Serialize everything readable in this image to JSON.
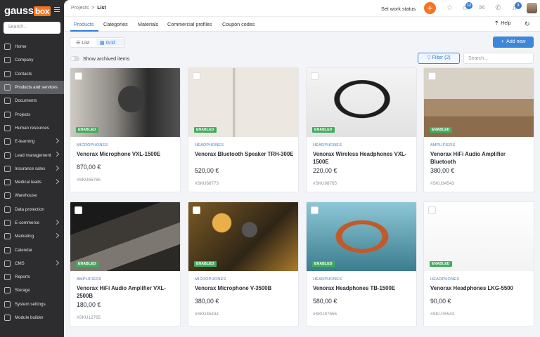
{
  "app": {
    "logo_text": "gauss",
    "logo_box": "box",
    "search_placeholder": "Search...",
    "brand_color": "#f37421",
    "accent_color": "#3d87d9"
  },
  "sidebar": {
    "items": [
      {
        "label": "Home",
        "icon": "home-icon",
        "chevron": false
      },
      {
        "label": "Company",
        "icon": "company-icon",
        "chevron": false
      },
      {
        "label": "Contacts",
        "icon": "contacts-icon",
        "chevron": false
      },
      {
        "label": "Products and services",
        "icon": "box-icon",
        "chevron": false,
        "active": true
      },
      {
        "label": "Documents",
        "icon": "document-icon",
        "chevron": false
      },
      {
        "label": "Projects",
        "icon": "folder-icon",
        "chevron": false
      },
      {
        "label": "Human resources",
        "icon": "people-icon",
        "chevron": false
      },
      {
        "label": "E-learning",
        "icon": "graduation-icon",
        "chevron": true
      },
      {
        "label": "Lead management",
        "icon": "funnel-icon",
        "chevron": true
      },
      {
        "label": "Insurance sales",
        "icon": "umbrella-icon",
        "chevron": true
      },
      {
        "label": "Medical leads",
        "icon": "medical-icon",
        "chevron": true
      },
      {
        "label": "Warehouse",
        "icon": "warehouse-icon",
        "chevron": false
      },
      {
        "label": "Data protection",
        "icon": "shield-icon",
        "chevron": false
      },
      {
        "label": "E-commerce",
        "icon": "cart-icon",
        "chevron": true
      },
      {
        "label": "Marketing",
        "icon": "megaphone-icon",
        "chevron": true
      },
      {
        "label": "Calendar",
        "icon": "calendar-icon",
        "chevron": false
      },
      {
        "label": "CMS",
        "icon": "cms-icon",
        "chevron": true
      },
      {
        "label": "Reports",
        "icon": "chart-icon",
        "chevron": false
      },
      {
        "label": "Storage",
        "icon": "storage-icon",
        "chevron": false
      },
      {
        "label": "System settings",
        "icon": "gear-icon",
        "chevron": false
      },
      {
        "label": "Module builder",
        "icon": "module-icon",
        "chevron": false
      }
    ]
  },
  "topbar": {
    "breadcrumb_parent": "Projects",
    "breadcrumb_sep": ">",
    "breadcrumb_current": "List",
    "work_status": "Set work status",
    "chat_badge": "12",
    "notif_badge": "3"
  },
  "tabs": {
    "items": [
      "Products",
      "Categories",
      "Materials",
      "Commercial profiles",
      "Coupon codes"
    ],
    "help": "Help"
  },
  "toolbar": {
    "list_label": "List",
    "grid_label": "Grid",
    "add_label": "Add new",
    "archived_label": "Show archived items",
    "filter_label": "Filter (2)",
    "search_placeholder": "Search..."
  },
  "products": [
    {
      "status": "ENABLED",
      "category": "MICROPHONES",
      "name": "Venorax Microphone VXL-1500E",
      "price": "870,00 €",
      "sku": "#SKU65765"
    },
    {
      "status": "ENABLED",
      "category": "HEADPHONES",
      "name": "Venorax Bluetooth Speaker TRH-300E",
      "price": "520,00 €",
      "sku": "#SKU68773"
    },
    {
      "status": "ENABLED",
      "category": "HEADPHONES",
      "name": "Venorax Wireless Headphones VXL-1500E",
      "price": "220,00 €",
      "sku": "#SKU98765"
    },
    {
      "status": "ENABLED",
      "category": "AMPLIFIERS",
      "name": "Venorax HiFi Audio Amplifier Bluetooth",
      "price": "380,00 €",
      "sku": "#SKU34543"
    },
    {
      "status": "ENABLED",
      "category": "AMPLIFIERS",
      "name": "Venorax HiFi Audio Amplifier VXL-2500B",
      "price": "180,00 €",
      "sku": "#SKU12765"
    },
    {
      "status": "ENABLED",
      "category": "MICROPHONES",
      "name": "Venorax Microphone V-3500B",
      "price": "380,00 €",
      "sku": "#SKU45434"
    },
    {
      "status": "ENABLED",
      "category": "HEADPHONES",
      "name": "Venorax Headphones TB-1500E",
      "price": "580,00 €",
      "sku": "#SKU87656"
    },
    {
      "status": "ENABLED",
      "category": "HEADPHONES",
      "name": "Venorax Headphones LKG-5500",
      "price": "90,00 €",
      "sku": "#SKU76543"
    }
  ]
}
